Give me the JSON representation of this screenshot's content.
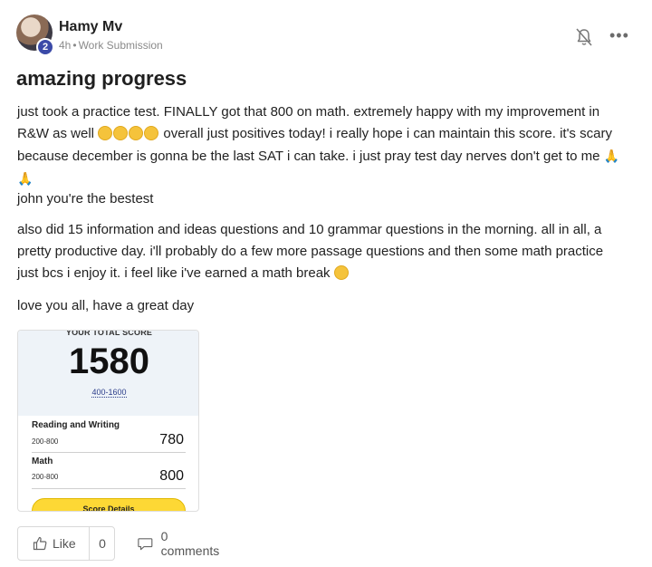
{
  "post": {
    "author": "Hamy Mv",
    "avatar_badge": "2",
    "time": "4h",
    "category": "Work Submission",
    "title": "amazing progress",
    "paragraph1_a": "just took a practice test. FINALLY got that 800 on math. extremely happy with my improvement in R&W as well",
    "paragraph1_b": "overall just positives today! i really hope i can maintain this score. it's scary because december is gonna be the last SAT i can take. i just pray test day nerves don't get to me",
    "paragraph2": "john you're the bestest",
    "paragraph3": "also did 15 information and ideas questions and 10 grammar questions in the morning. all in all, a pretty productive day. i'll probably do a few more passage questions and then some math practice just bcs i enjoy it. i feel like i've earned a math break",
    "paragraph4": "love you all, have a great day"
  },
  "score_card": {
    "heading": "YOUR TOTAL SCORE",
    "total": "1580",
    "range": "400-1600",
    "sections": [
      {
        "label": "Reading and Writing",
        "range": "200-800",
        "score": "780"
      },
      {
        "label": "Math",
        "range": "200-800",
        "score": "800"
      }
    ],
    "button_label": "Score Details"
  },
  "actions": {
    "like_label": "Like",
    "like_count": "0",
    "comments_label": "0 comments"
  },
  "icons": {
    "notification": "bell-off-icon",
    "more": "more-horizontal-icon",
    "like": "thumbs-up-icon",
    "comment": "comment-bubble-icon"
  },
  "colors": {
    "badge": "#3b4aa8",
    "score_button": "#fdd835",
    "score_header_bg": "#eef3f8"
  }
}
